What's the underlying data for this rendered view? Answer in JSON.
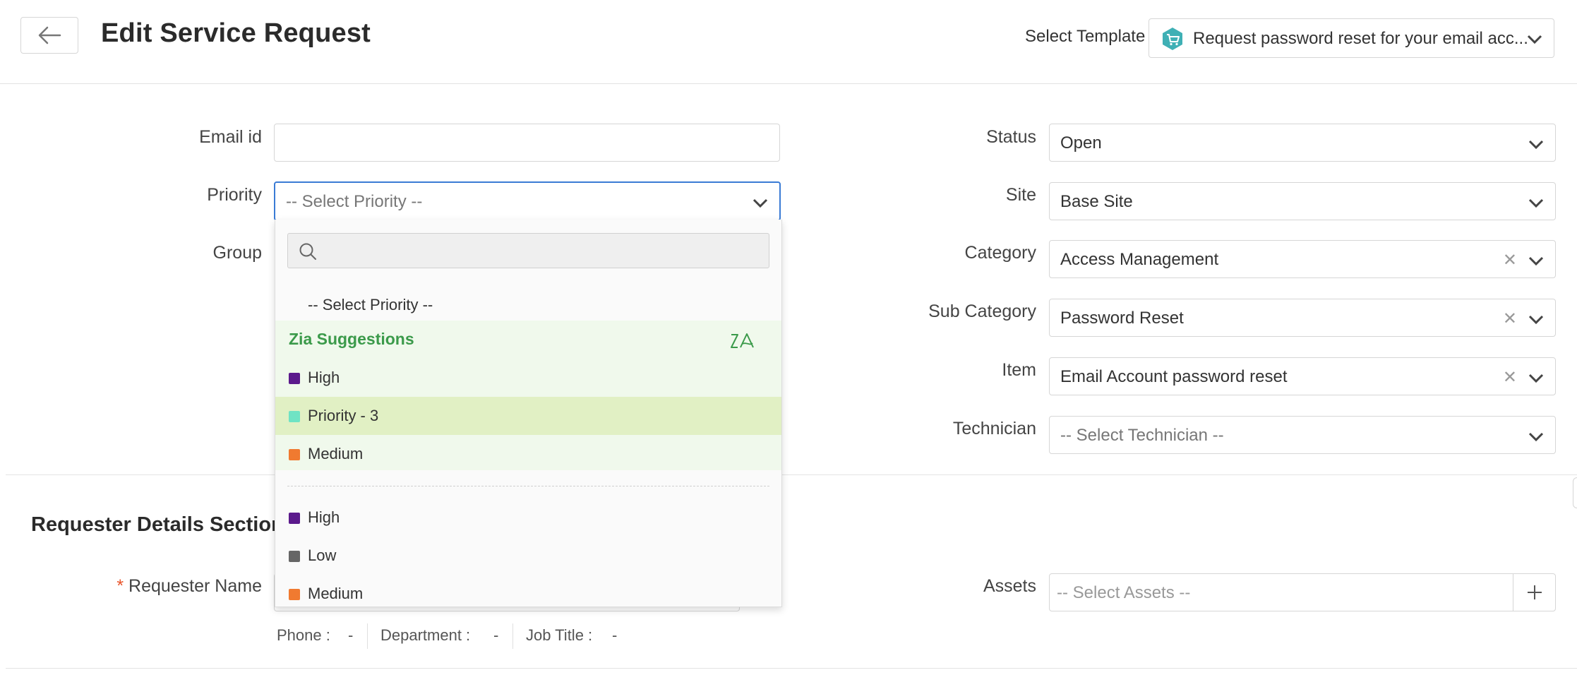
{
  "header": {
    "title": "Edit Service Request",
    "template_label": "Select Template",
    "template_value": "Request password reset for your email acc..."
  },
  "form": {
    "email_label": "Email id",
    "email_value": "",
    "priority_label": "Priority",
    "priority_placeholder": "-- Select Priority --",
    "group_label": "Group",
    "status_label": "Status",
    "status_value": "Open",
    "site_label": "Site",
    "site_value": "Base Site",
    "category_label": "Category",
    "category_value": "Access Management",
    "subcategory_label": "Sub Category",
    "subcategory_value": "Password Reset",
    "item_label": "Item",
    "item_value": "Email Account password reset",
    "technician_label": "Technician",
    "technician_placeholder": "-- Select Technician --"
  },
  "dropdown": {
    "placeholder_option": "-- Select Priority --",
    "zia_title": "Zia Suggestions",
    "zia_icon": "zia-icon",
    "suggestions": [
      {
        "label": "High",
        "color": "#5b1a8c"
      },
      {
        "label": "Priority - 3",
        "color": "#6fe3c4"
      },
      {
        "label": "Medium",
        "color": "#f07a30"
      }
    ],
    "options": [
      {
        "label": "High",
        "color": "#5b1a8c"
      },
      {
        "label": "Low",
        "color": "#666666"
      },
      {
        "label": "Medium",
        "color": "#f07a30"
      }
    ]
  },
  "requester": {
    "section_title": "Requester Details Section",
    "required_mark": "*",
    "name_label": "Requester Name",
    "phone_label": "Phone :",
    "phone_value": "-",
    "department_label": "Department :",
    "department_value": "-",
    "jobtitle_label": "Job Title :",
    "jobtitle_value": "-",
    "assets_label": "Assets",
    "assets_placeholder": "-- Select Assets --"
  },
  "colors": {
    "accent_focus": "#3a7bd5",
    "zia_green": "#3b9a4a",
    "required_red": "#e8542a"
  }
}
